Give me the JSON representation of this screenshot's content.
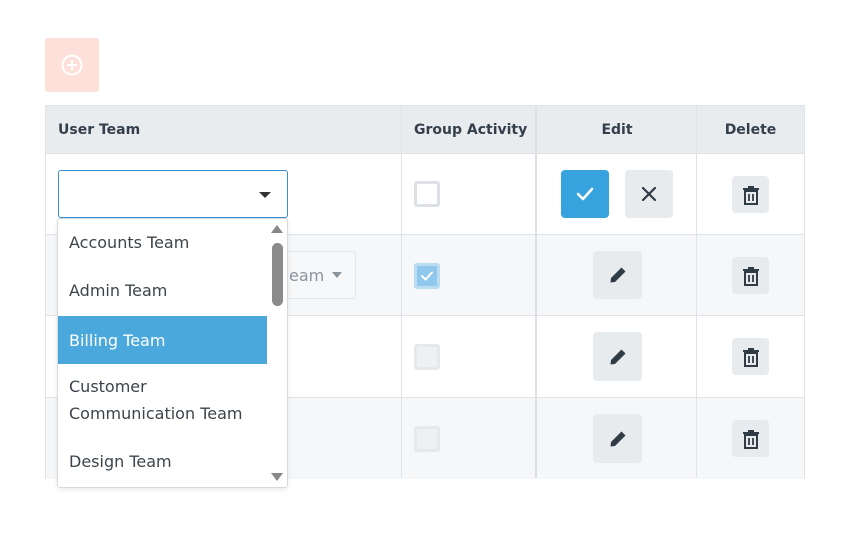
{
  "toolbar": {
    "add_icon": "plus-circle-icon",
    "add_color": "#fde0d9"
  },
  "grid": {
    "columns": [
      "User Team",
      "Group Activity",
      "Edit",
      "Delete"
    ],
    "rows": [
      {
        "user_team": "",
        "group_activity": false,
        "mode": "editing"
      },
      {
        "user_team": "eam",
        "group_activity": true,
        "mode": "view"
      },
      {
        "user_team": "",
        "group_activity": false,
        "mode": "view"
      },
      {
        "user_team": "",
        "group_activity": false,
        "mode": "view"
      }
    ]
  },
  "dropdown": {
    "options": [
      "Accounts Team",
      "Admin Team",
      "Billing Team",
      "Customer Communication Team",
      "Design Team"
    ],
    "highlighted": "Billing Team",
    "highlight_color": "#4aa8dc"
  },
  "colors": {
    "primary": "#36a3df",
    "header_bg": "#e9ecef"
  }
}
